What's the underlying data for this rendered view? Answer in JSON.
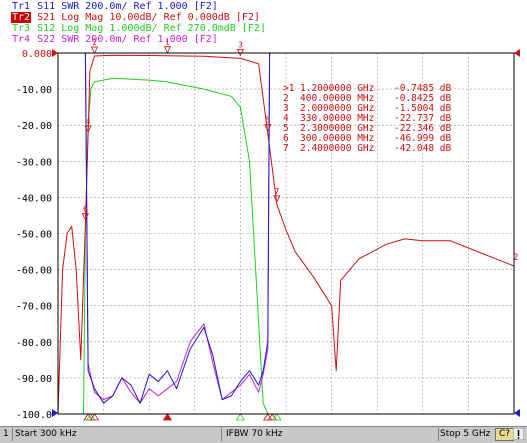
{
  "traces": [
    {
      "id": "Tr1",
      "param": "S11",
      "format": "SWR",
      "scale": "200.0m/",
      "ref": "Ref 1.000",
      "window": "[F2]",
      "color": "#1a1ad0",
      "active": false
    },
    {
      "id": "Tr2",
      "param": "S21",
      "format": "Log Mag",
      "scale": "10.00dB/",
      "ref": "Ref 0.000dB",
      "window": "[F2]",
      "color": "#cc1111",
      "active": true
    },
    {
      "id": "Tr3",
      "param": "S12",
      "format": "Log Mag",
      "scale": "1.000dB/",
      "ref": "Ref 270.0mdB",
      "window": "[F2]",
      "color": "#22cc22",
      "active": false
    },
    {
      "id": "Tr4",
      "param": "S22",
      "format": "SWR",
      "scale": "200.0m/",
      "ref": "Ref 1.000",
      "window": "[F2]",
      "color": "#cc22cc",
      "active": false
    }
  ],
  "y_axis_labels": [
    "0.000",
    "-10.00",
    "-20.00",
    "-30.00",
    "-40.00",
    "-50.00",
    "-60.00",
    "-70.00",
    "-80.00",
    "-90.00",
    "-100.0"
  ],
  "marker_table": [
    {
      "prefix": ">1",
      "freq": "1.2000000 GHz",
      "value": "-0.7485 dB"
    },
    {
      "prefix": "2",
      "freq": "400.00000 MHz",
      "value": "-0.8425 dB"
    },
    {
      "prefix": "3",
      "freq": "2.0000000 GHz",
      "value": "-1.5004 dB"
    },
    {
      "prefix": "4",
      "freq": "330.00000 MHz",
      "value": "-22.737 dB"
    },
    {
      "prefix": "5",
      "freq": "2.3000000 GHz",
      "value": "-22.346 dB"
    },
    {
      "prefix": "6",
      "freq": "300.00000 MHz",
      "value": "-46.999 dB"
    },
    {
      "prefix": "7",
      "freq": "2.4000000 GHz",
      "value": "-42.048 dB"
    }
  ],
  "right_trace_label": "2",
  "status": {
    "channel": "1",
    "start": "Start 300 kHz",
    "ifbw": "IFBW 70 kHz",
    "stop": "Stop 5 GHz",
    "badge": "C?"
  },
  "chart_data": [
    {
      "type": "line",
      "title": "",
      "x_range_ghz": [
        0.0003,
        5
      ],
      "ylim": [
        -100,
        0
      ],
      "ylabel": "dB",
      "grid": true,
      "series": [
        {
          "name": "S21",
          "color": "#cc1111",
          "x": [
            0.0003,
            0.05,
            0.1,
            0.15,
            0.2,
            0.25,
            0.3,
            0.33,
            0.35,
            0.4,
            0.6,
            1.0,
            1.2,
            1.6,
            2.0,
            2.2,
            2.3,
            2.4,
            2.5,
            2.6,
            2.8,
            3.0,
            3.05,
            3.1,
            3.3,
            3.6,
            3.8,
            4.0,
            4.3,
            4.6,
            4.8,
            5.0
          ],
          "y": [
            -100,
            -60,
            -50,
            -48,
            -60,
            -85,
            -47,
            -22.7,
            -5,
            -0.84,
            -0.6,
            -0.7,
            -0.75,
            -0.9,
            -1.5,
            -3,
            -22.3,
            -42,
            -49,
            -55,
            -62,
            -70,
            -88,
            -63,
            -57,
            -53,
            -51.5,
            -52,
            -52,
            -55,
            -57,
            -59
          ]
        },
        {
          "name": "S12",
          "color": "#22cc22",
          "x": [
            0.0003,
            0.28,
            0.3,
            0.33,
            0.36,
            0.4,
            0.6,
            1.0,
            1.2,
            1.6,
            1.9,
            2.0,
            2.1,
            2.25,
            2.3,
            2.32,
            2.4,
            5.0
          ],
          "y": [
            -100,
            -100,
            -50,
            -20,
            -10,
            -8,
            -7,
            -7.5,
            -8,
            -10,
            -12,
            -15,
            -30,
            -97,
            -100,
            -100,
            -100,
            -100
          ]
        },
        {
          "name": "S11",
          "color": "#1a1ad0",
          "x": [
            0.0003,
            0.3,
            0.33,
            0.4,
            0.5,
            0.6,
            0.7,
            0.8,
            0.9,
            1.0,
            1.1,
            1.2,
            1.3,
            1.45,
            1.6,
            1.7,
            1.8,
            1.9,
            2.0,
            2.1,
            2.2,
            2.25,
            2.3,
            2.32,
            5.0
          ],
          "y": [
            0,
            0,
            -88,
            -93,
            -97,
            -95,
            -90,
            -92,
            -97,
            -89,
            -91,
            -88,
            -93,
            -82,
            -76,
            -84,
            -96,
            -95,
            -91,
            -88,
            -92,
            -88,
            -80,
            0,
            0
          ]
        },
        {
          "name": "S22",
          "color": "#cc22cc",
          "x": [
            0.0003,
            0.3,
            0.33,
            0.4,
            0.5,
            0.6,
            0.7,
            0.8,
            0.9,
            1.0,
            1.1,
            1.2,
            1.3,
            1.45,
            1.6,
            1.7,
            1.8,
            1.9,
            2.0,
            2.1,
            2.2,
            2.25,
            2.3,
            2.32,
            5.0
          ],
          "y": [
            0,
            0,
            -86,
            -94,
            -96,
            -95,
            -90,
            -94,
            -97,
            -93,
            -95,
            -93,
            -91,
            -80,
            -75,
            -86,
            -96,
            -94,
            -92,
            -89,
            -94,
            -89,
            -82,
            0,
            0
          ]
        }
      ],
      "markers": [
        {
          "label": "1",
          "trace": "S21",
          "x": 1.2,
          "y": -0.7485
        },
        {
          "label": "2",
          "trace": "S21",
          "x": 0.4,
          "y": -0.8425
        },
        {
          "label": "3",
          "trace": "S21",
          "x": 2.0,
          "y": -1.5004
        },
        {
          "label": "4",
          "trace": "S21",
          "x": 0.33,
          "y": -22.737
        },
        {
          "label": "5",
          "trace": "S21",
          "x": 2.3,
          "y": -22.346
        },
        {
          "label": "6",
          "trace": "S21",
          "x": 0.3,
          "y": -46.999
        },
        {
          "label": "7",
          "trace": "S21",
          "x": 2.4,
          "y": -42.048
        }
      ]
    }
  ]
}
